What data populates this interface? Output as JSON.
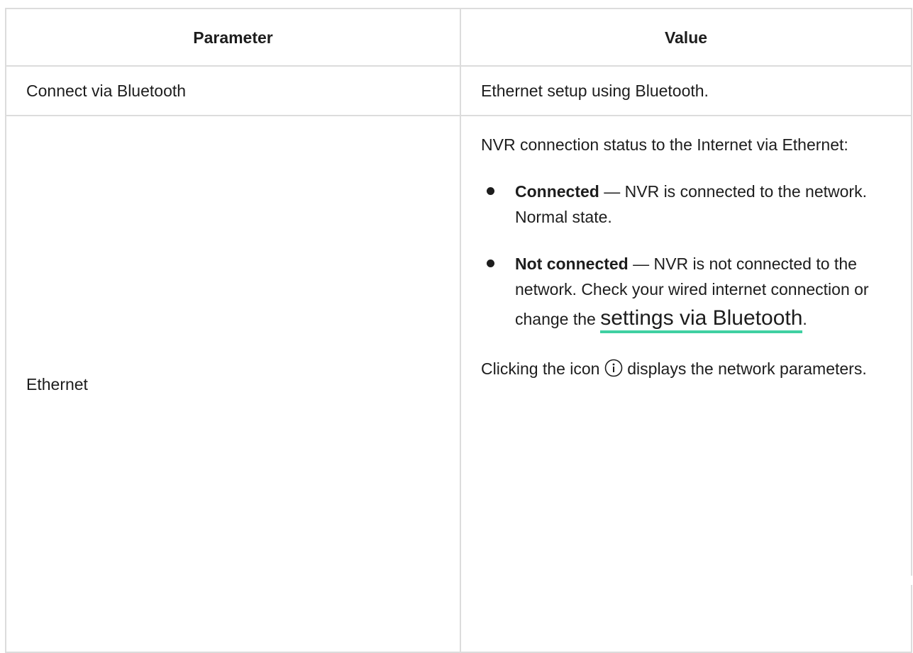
{
  "table": {
    "headers": [
      "Parameter",
      "Value"
    ],
    "rows": [
      {
        "parameter": "Connect via Bluetooth",
        "value": "Ethernet setup using Bluetooth."
      },
      {
        "parameter": "Ethernet",
        "intro": "NVR connection status to the Internet via Ethernet:",
        "items": [
          {
            "term": "Connected",
            "desc": " — NVR is connected to the network. Normal state."
          },
          {
            "term": "Not connected",
            "desc": " — NVR is not connected to the network. Check your wired internet connection or change the ",
            "link": "settings via Bluetooth",
            "after": "."
          }
        ],
        "footer_before": "Clicking the icon ",
        "footer_icon": "info-icon",
        "footer_after": " displays the network parameters."
      }
    ]
  },
  "colors": {
    "border": "#dcdcdc",
    "link_underline": "#3fd0a2",
    "text": "#1d1d1d"
  }
}
